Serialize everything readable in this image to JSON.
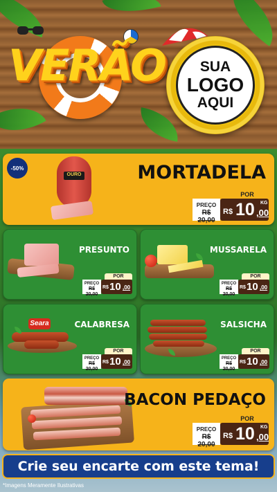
{
  "header": {
    "title": "VERÃO",
    "logo_lines": [
      "SUA",
      "LOGO",
      "AQUI"
    ]
  },
  "colors": {
    "accent": "#f6b31a",
    "green": "#2e8f34",
    "navy": "#173e8c",
    "price_bg": "#4a2514"
  },
  "featured_top": {
    "name": "MORTADELA",
    "discount": "-50%",
    "brand": "OURO",
    "por_label": "POR",
    "preco_label": "PREÇO",
    "old_price": "R$ 20,00",
    "currency": "R$",
    "price_int": "10",
    "price_dec": ",00",
    "unit": "KG"
  },
  "grid": [
    {
      "name": "PRESUNTO",
      "por_label": "POR",
      "preco_label": "PREÇO",
      "old_price": "R$ 20,00",
      "currency": "R$",
      "price_int": "10",
      "price_dec": ",00"
    },
    {
      "name": "MUSSARELA",
      "por_label": "POR",
      "preco_label": "PREÇO",
      "old_price": "R$ 20,00",
      "currency": "R$",
      "price_int": "10",
      "price_dec": ",00"
    },
    {
      "name": "CALABRESA",
      "brand": "Seara",
      "por_label": "POR",
      "preco_label": "PREÇO",
      "old_price": "R$ 20,00",
      "currency": "R$",
      "price_int": "10",
      "price_dec": ",00"
    },
    {
      "name": "SALSICHA",
      "por_label": "POR",
      "preco_label": "PREÇO",
      "old_price": "R$ 20,00",
      "currency": "R$",
      "price_int": "10",
      "price_dec": ",00"
    }
  ],
  "featured_bottom": {
    "name": "BACON PEDAÇO",
    "por_label": "POR",
    "preco_label": "PREÇO",
    "old_price": "R$ 20,00",
    "currency": "R$",
    "price_int": "10",
    "price_dec": ",00",
    "unit": "KG"
  },
  "cta_text": "Crie seu encarte com este tema!",
  "disclaimer": "*Imagens Meramente Ilustrativas"
}
